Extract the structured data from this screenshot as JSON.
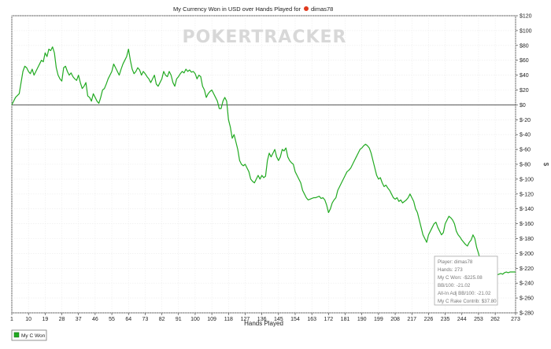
{
  "chart_data": {
    "type": "line",
    "title": "My Currency Won in USD over Hands Played for",
    "title_player": "dimas78",
    "xlabel": "Hands Played",
    "ylabel": "$",
    "watermark": "POKERTRACKER",
    "xlim": [
      1,
      273
    ],
    "ylim": [
      -280,
      120
    ],
    "grid": true,
    "x_ticks": [
      1,
      10,
      19,
      28,
      37,
      46,
      55,
      64,
      73,
      82,
      91,
      100,
      109,
      118,
      127,
      136,
      145,
      154,
      163,
      172,
      181,
      190,
      199,
      208,
      217,
      226,
      235,
      244,
      253,
      262,
      273
    ],
    "y_ticks": [
      120,
      100,
      80,
      60,
      40,
      20,
      0,
      -20,
      -40,
      -60,
      -80,
      -100,
      -120,
      -140,
      -160,
      -180,
      -200,
      -220,
      -240,
      -260,
      -280
    ],
    "y_tick_labels": [
      "$120",
      "$100",
      "$80",
      "$60",
      "$40",
      "$20",
      "$0",
      "$-20",
      "$-40",
      "$-60",
      "$-80",
      "$-100",
      "$-120",
      "$-140",
      "$-160",
      "$-180",
      "$-200",
      "$-220",
      "$-240",
      "$-260",
      "$-280"
    ],
    "series": [
      {
        "name": "My C Won",
        "color": "#22aa22",
        "points": [
          [
            1,
            0
          ],
          [
            3,
            10
          ],
          [
            5,
            15
          ],
          [
            7,
            45
          ],
          [
            8,
            52
          ],
          [
            9,
            50
          ],
          [
            10,
            45
          ],
          [
            11,
            42
          ],
          [
            12,
            48
          ],
          [
            13,
            40
          ],
          [
            14,
            45
          ],
          [
            15,
            50
          ],
          [
            16,
            55
          ],
          [
            17,
            60
          ],
          [
            18,
            58
          ],
          [
            19,
            70
          ],
          [
            20,
            65
          ],
          [
            21,
            75
          ],
          [
            22,
            73
          ],
          [
            23,
            78
          ],
          [
            24,
            70
          ],
          [
            25,
            50
          ],
          [
            26,
            40
          ],
          [
            27,
            35
          ],
          [
            28,
            32
          ],
          [
            29,
            50
          ],
          [
            30,
            52
          ],
          [
            31,
            45
          ],
          [
            32,
            40
          ],
          [
            33,
            43
          ],
          [
            34,
            38
          ],
          [
            35,
            35
          ],
          [
            36,
            33
          ],
          [
            37,
            40
          ],
          [
            38,
            30
          ],
          [
            39,
            22
          ],
          [
            40,
            25
          ],
          [
            41,
            30
          ],
          [
            42,
            12
          ],
          [
            43,
            10
          ],
          [
            44,
            5
          ],
          [
            45,
            15
          ],
          [
            46,
            10
          ],
          [
            47,
            5
          ],
          [
            48,
            2
          ],
          [
            49,
            10
          ],
          [
            50,
            20
          ],
          [
            51,
            22
          ],
          [
            52,
            28
          ],
          [
            53,
            35
          ],
          [
            54,
            40
          ],
          [
            55,
            45
          ],
          [
            56,
            55
          ],
          [
            57,
            50
          ],
          [
            58,
            45
          ],
          [
            59,
            40
          ],
          [
            60,
            48
          ],
          [
            61,
            55
          ],
          [
            62,
            60
          ],
          [
            63,
            65
          ],
          [
            64,
            75
          ],
          [
            65,
            60
          ],
          [
            66,
            48
          ],
          [
            67,
            42
          ],
          [
            68,
            45
          ],
          [
            69,
            50
          ],
          [
            70,
            47
          ],
          [
            71,
            40
          ],
          [
            72,
            45
          ],
          [
            73,
            42
          ],
          [
            74,
            38
          ],
          [
            75,
            35
          ],
          [
            76,
            30
          ],
          [
            77,
            35
          ],
          [
            78,
            40
          ],
          [
            79,
            28
          ],
          [
            80,
            25
          ],
          [
            81,
            30
          ],
          [
            82,
            35
          ],
          [
            83,
            45
          ],
          [
            84,
            40
          ],
          [
            85,
            38
          ],
          [
            86,
            45
          ],
          [
            87,
            40
          ],
          [
            88,
            30
          ],
          [
            89,
            25
          ],
          [
            90,
            35
          ],
          [
            91,
            38
          ],
          [
            92,
            42
          ],
          [
            93,
            45
          ],
          [
            94,
            43
          ],
          [
            95,
            48
          ],
          [
            96,
            45
          ],
          [
            97,
            47
          ],
          [
            98,
            44
          ],
          [
            99,
            45
          ],
          [
            100,
            42
          ],
          [
            101,
            35
          ],
          [
            102,
            40
          ],
          [
            103,
            38
          ],
          [
            104,
            25
          ],
          [
            105,
            20
          ],
          [
            106,
            10
          ],
          [
            107,
            15
          ],
          [
            108,
            18
          ],
          [
            109,
            20
          ],
          [
            110,
            15
          ],
          [
            111,
            10
          ],
          [
            112,
            5
          ],
          [
            113,
            -5
          ],
          [
            114,
            -5
          ],
          [
            115,
            5
          ],
          [
            116,
            10
          ],
          [
            117,
            5
          ],
          [
            118,
            -20
          ],
          [
            119,
            -30
          ],
          [
            120,
            -45
          ],
          [
            121,
            -40
          ],
          [
            122,
            -50
          ],
          [
            123,
            -60
          ],
          [
            124,
            -75
          ],
          [
            125,
            -80
          ],
          [
            126,
            -82
          ],
          [
            127,
            -80
          ],
          [
            128,
            -85
          ],
          [
            129,
            -90
          ],
          [
            130,
            -100
          ],
          [
            131,
            -103
          ],
          [
            132,
            -105
          ],
          [
            133,
            -100
          ],
          [
            134,
            -95
          ],
          [
            135,
            -100
          ],
          [
            136,
            -95
          ],
          [
            137,
            -98
          ],
          [
            138,
            -96
          ],
          [
            139,
            -75
          ],
          [
            140,
            -65
          ],
          [
            141,
            -70
          ],
          [
            142,
            -65
          ],
          [
            143,
            -60
          ],
          [
            144,
            -70
          ],
          [
            145,
            -75
          ],
          [
            146,
            -70
          ],
          [
            147,
            -60
          ],
          [
            148,
            -62
          ],
          [
            149,
            -58
          ],
          [
            150,
            -70
          ],
          [
            151,
            -75
          ],
          [
            152,
            -78
          ],
          [
            153,
            -80
          ],
          [
            154,
            -90
          ],
          [
            155,
            -95
          ],
          [
            156,
            -100
          ],
          [
            157,
            -105
          ],
          [
            158,
            -115
          ],
          [
            159,
            -120
          ],
          [
            160,
            -125
          ],
          [
            161,
            -128
          ],
          [
            162,
            -127
          ],
          [
            163,
            -126
          ],
          [
            164,
            -125
          ],
          [
            165,
            -125
          ],
          [
            166,
            -124
          ],
          [
            167,
            -123
          ],
          [
            168,
            -126
          ],
          [
            169,
            -125
          ],
          [
            170,
            -128
          ],
          [
            171,
            -135
          ],
          [
            172,
            -145
          ],
          [
            173,
            -140
          ],
          [
            174,
            -132
          ],
          [
            175,
            -128
          ],
          [
            176,
            -125
          ],
          [
            177,
            -115
          ],
          [
            178,
            -110
          ],
          [
            179,
            -105
          ],
          [
            180,
            -100
          ],
          [
            181,
            -95
          ],
          [
            182,
            -90
          ],
          [
            183,
            -88
          ],
          [
            184,
            -85
          ],
          [
            185,
            -80
          ],
          [
            186,
            -75
          ],
          [
            187,
            -70
          ],
          [
            188,
            -65
          ],
          [
            189,
            -60
          ],
          [
            190,
            -58
          ],
          [
            191,
            -55
          ],
          [
            192,
            -53
          ],
          [
            193,
            -55
          ],
          [
            194,
            -58
          ],
          [
            195,
            -65
          ],
          [
            196,
            -75
          ],
          [
            197,
            -85
          ],
          [
            198,
            -95
          ],
          [
            199,
            -100
          ],
          [
            200,
            -98
          ],
          [
            201,
            -105
          ],
          [
            202,
            -110
          ],
          [
            203,
            -108
          ],
          [
            204,
            -112
          ],
          [
            205,
            -115
          ],
          [
            206,
            -120
          ],
          [
            207,
            -125
          ],
          [
            208,
            -127
          ],
          [
            209,
            -125
          ],
          [
            210,
            -130
          ],
          [
            211,
            -128
          ],
          [
            212,
            -132
          ],
          [
            213,
            -130
          ],
          [
            214,
            -128
          ],
          [
            215,
            -125
          ],
          [
            216,
            -120
          ],
          [
            217,
            -125
          ],
          [
            218,
            -130
          ],
          [
            219,
            -140
          ],
          [
            220,
            -145
          ],
          [
            221,
            -155
          ],
          [
            222,
            -165
          ],
          [
            223,
            -175
          ],
          [
            224,
            -180
          ],
          [
            225,
            -185
          ],
          [
            226,
            -175
          ],
          [
            227,
            -170
          ],
          [
            228,
            -165
          ],
          [
            229,
            -160
          ],
          [
            230,
            -158
          ],
          [
            231,
            -165
          ],
          [
            232,
            -170
          ],
          [
            233,
            -175
          ],
          [
            234,
            -172
          ],
          [
            235,
            -160
          ],
          [
            236,
            -155
          ],
          [
            237,
            -150
          ],
          [
            238,
            -152
          ],
          [
            239,
            -155
          ],
          [
            240,
            -160
          ],
          [
            241,
            -170
          ],
          [
            242,
            -175
          ],
          [
            243,
            -178
          ],
          [
            244,
            -182
          ],
          [
            245,
            -185
          ],
          [
            246,
            -188
          ],
          [
            247,
            -190
          ],
          [
            248,
            -185
          ],
          [
            249,
            -182
          ],
          [
            250,
            -175
          ],
          [
            251,
            -180
          ],
          [
            252,
            -192
          ],
          [
            253,
            -200
          ],
          [
            254,
            -210
          ],
          [
            255,
            -215
          ],
          [
            256,
            -210
          ],
          [
            257,
            -220
          ],
          [
            258,
            -225
          ],
          [
            259,
            -226
          ],
          [
            260,
            -227
          ],
          [
            261,
            -226
          ],
          [
            262,
            -228
          ],
          [
            263,
            -229
          ],
          [
            264,
            -228
          ],
          [
            265,
            -227
          ],
          [
            266,
            -228
          ],
          [
            267,
            -226
          ],
          [
            268,
            -225
          ],
          [
            269,
            -226
          ],
          [
            270,
            -225
          ],
          [
            271,
            -225
          ],
          [
            272,
            -225
          ],
          [
            273,
            -225
          ]
        ]
      }
    ],
    "stats_box": [
      "Player: dimas78",
      "Hands: 273",
      "My C Won: -$225.08",
      "BB/100: -21.02",
      "All-In Adj BB/100: -21.02",
      "My C Rake Contrib: $37.80"
    ],
    "legend": {
      "label": "My C Won",
      "color": "#22aa22",
      "placement": "bottom-left"
    }
  }
}
